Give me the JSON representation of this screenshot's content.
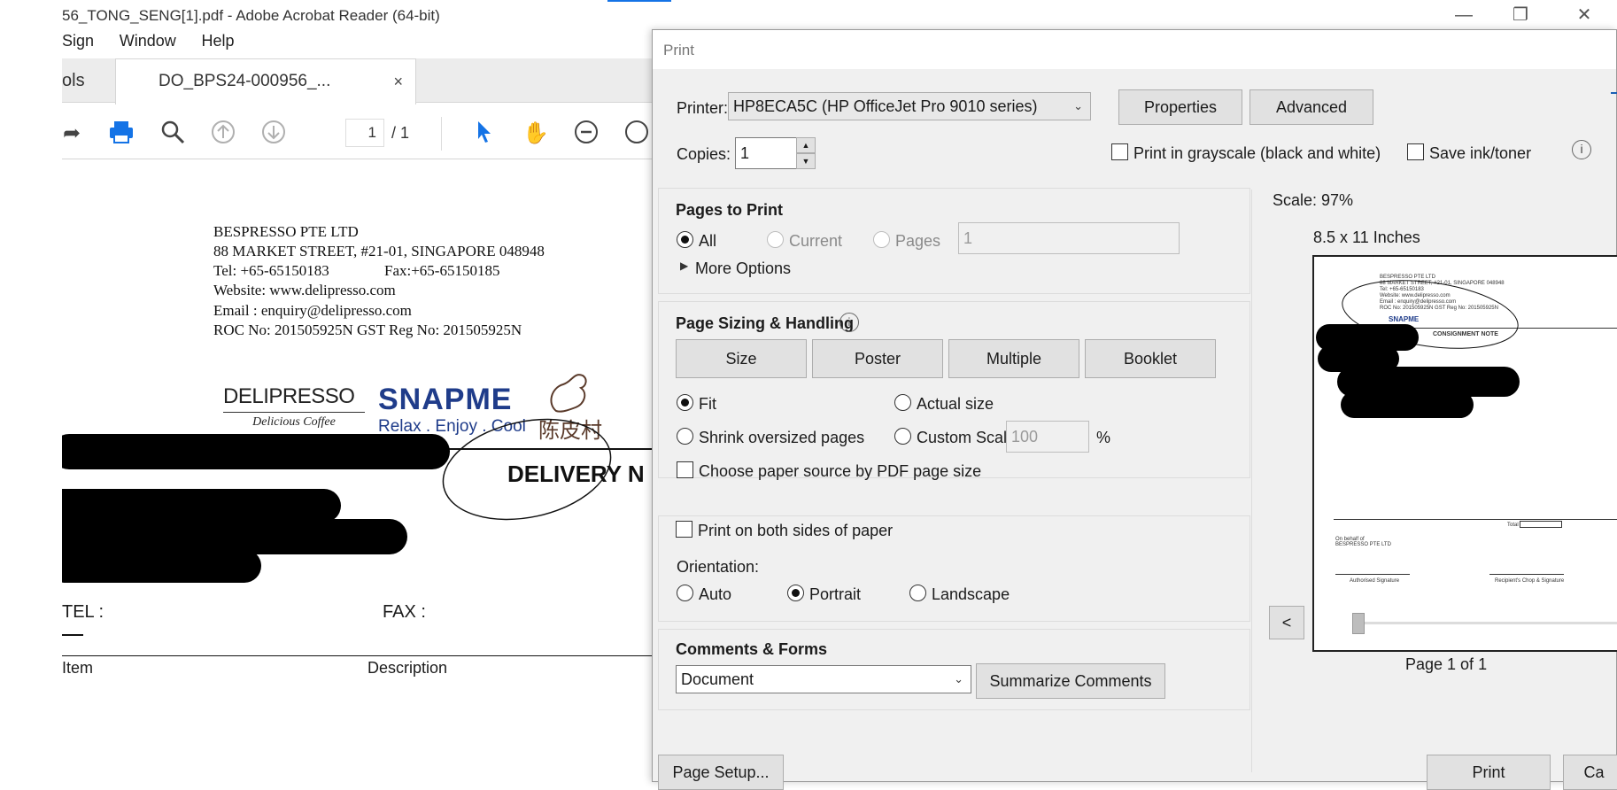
{
  "window": {
    "title": "56_TONG_SENG[1].pdf - Adobe Acrobat Reader (64-bit)",
    "minimize_icon": "minimize-icon",
    "restore_icon": "restore-icon",
    "close_icon": "close-icon"
  },
  "menu": {
    "items": [
      "Sign",
      "Window",
      "Help"
    ]
  },
  "tabs": {
    "tools_label": "ols",
    "doc_label": "DO_BPS24-000956_...",
    "close_glyph": "×"
  },
  "toolbar": {
    "page_current": "1",
    "page_total": "/  1"
  },
  "document": {
    "company": "BESPRESSO PTE LTD",
    "address": "88 MARKET STREET, #21-01, SINGAPORE 048948",
    "tel": "Tel: +65-65150183",
    "fax": "Fax:+65-65150185",
    "website": "Website: www.delipresso.com",
    "email": "Email : enquiry@delipresso.com",
    "roc": "ROC No: 201505925N  GST Reg No: 201505925N",
    "logo1_name": "DELIPRESSO",
    "logo1_tag": "Delicious Coffee",
    "logo2_name": "SNAPME",
    "logo2_tag": "Relax . Enjoy . Cool",
    "logo3_name": "陈皮村",
    "heading": "DELIVERY N",
    "tel_label": "TEL :",
    "fax_label": "FAX  :",
    "col_item": "Item",
    "col_desc": "Description"
  },
  "dialog": {
    "title": "Print",
    "printer_label": "Printer:",
    "printer_value": "HP8ECA5C (HP OfficeJet Pro 9010 series)",
    "properties_label": "Properties",
    "advanced_label": "Advanced",
    "copies_label": "Copies:",
    "copies_value": "1",
    "grayscale_label": "Print in grayscale (black and white)",
    "saveink_label": "Save ink/toner",
    "pages_to_print": {
      "title": "Pages to Print",
      "all": "All",
      "current": "Current",
      "pages": "Pages",
      "pages_value": "1",
      "more_options": "More Options"
    },
    "sizing": {
      "title": "Page Sizing & Handling",
      "size_btn": "Size",
      "poster_btn": "Poster",
      "multiple_btn": "Multiple",
      "booklet_btn": "Booklet",
      "fit": "Fit",
      "actual": "Actual size",
      "shrink": "Shrink oversized pages",
      "custom": "Custom Scale:",
      "custom_value": "100",
      "percent": "%",
      "paper_source": "Choose paper source by PDF page size"
    },
    "both_sides": "Print on both sides of paper",
    "orientation": {
      "label": "Orientation:",
      "auto": "Auto",
      "portrait": "Portrait",
      "landscape": "Landscape",
      "selected": "Portrait"
    },
    "comments": {
      "title": "Comments & Forms",
      "value": "Document",
      "summarize": "Summarize Comments"
    },
    "preview": {
      "scale": "Scale:  97%",
      "paper": "8.5 x 11 Inches",
      "prev_btn": "<",
      "page_info": "Page 1 of 1",
      "note_title": "CONSIGNMENT NOTE",
      "total_label": "Total",
      "behalf": "On behalf of",
      "company": "BESPRESSO PTE LTD",
      "auth_sig": "Authorised Signature",
      "recv_sig": "Recipient's Chop & Signature"
    },
    "page_setup": "Page Setup...",
    "print_btn": "Print",
    "cancel_btn": "Ca"
  }
}
